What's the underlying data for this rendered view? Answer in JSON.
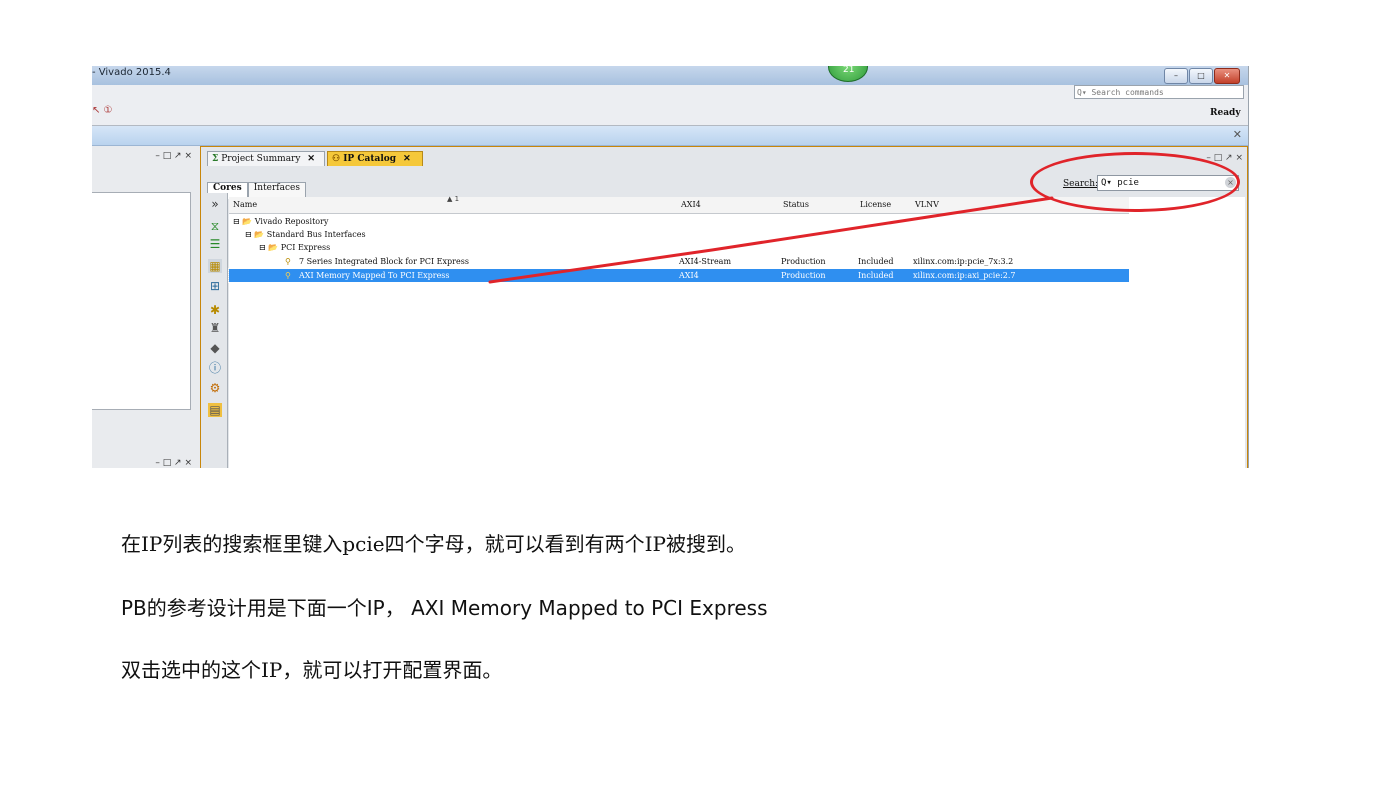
{
  "window": {
    "title": "- Vivado 2015.4",
    "badge": "21",
    "btn_min": "–",
    "btn_max": "□",
    "btn_close": "✕"
  },
  "toolbar": {
    "search_placeholder": "Q▾ Search commands",
    "status": "Ready",
    "icons": "↖ ①"
  },
  "bluebar": {
    "close": "✕"
  },
  "left_panel": {
    "controls": "– □ ↗ ×",
    "controls_bottom": "– □ ↗ ×"
  },
  "tabs": [
    {
      "label": "Project Summary",
      "icon": "Σ",
      "close": "✕"
    },
    {
      "label": "IP Catalog",
      "icon": "⚇",
      "close": "✕"
    }
  ],
  "panel_controls": "– □ ↗ ×",
  "subtabs": {
    "cores": "Cores",
    "interfaces": "Interfaces"
  },
  "search": {
    "label": "Search:",
    "value": "Q▾ pcie",
    "clear": "×"
  },
  "columns": {
    "name": "Name",
    "axi4": "AXI4",
    "status": "Status",
    "license": "License",
    "vlnv": "VLNV",
    "sort": "▲ 1"
  },
  "tree": {
    "repo": "⊟ 📂 Vivado Repository",
    "bus": "⊟ 📂 Standard Bus Interfaces",
    "pci": "⊟ 📂 PCI Express"
  },
  "rows": [
    {
      "name": "7 Series Integrated Block for PCI Express",
      "axi4": "AXI4-Stream",
      "status": "Production",
      "license": "Included",
      "vlnv": "xilinx.com:ip:pcie_7x:3.2"
    },
    {
      "name": "AXI Memory Mapped To PCI Express",
      "axi4": "AXI4",
      "status": "Production",
      "license": "Included",
      "vlnv": "xilinx.com:ip:axi_pcie:2.7"
    }
  ],
  "side_icons": [
    "gear",
    "filter",
    "layers",
    "chip",
    "tree",
    "star",
    "repo",
    "diamond",
    "info",
    "settings",
    "doc"
  ],
  "captions": {
    "line1": "在IP列表的搜索框里键入pcie四个字母，就可以看到有两个IP被搜到。",
    "line2": "PB的参考设计用是下面一个IP， AXI Memory Mapped to PCI Express",
    "line3": "双击选中的这个IP，就可以打开配置界面。"
  },
  "colors": {
    "selection": "#2f8ff0",
    "annotation": "#e0242a",
    "active_tab": "#f5c83a"
  }
}
